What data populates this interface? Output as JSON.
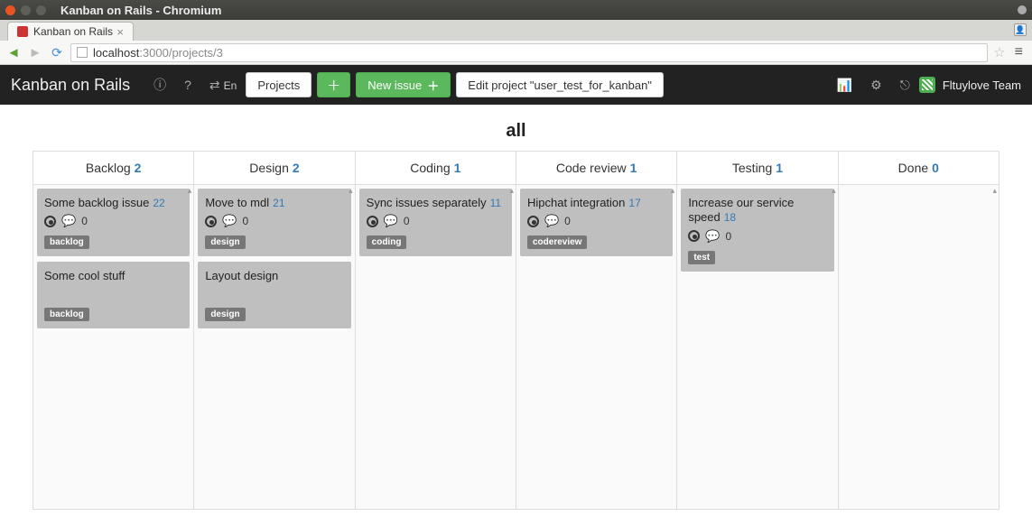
{
  "window": {
    "title": "Kanban on Rails - Chromium"
  },
  "tab": {
    "label": "Kanban on Rails"
  },
  "url": {
    "host": "localhost",
    "rest": ":3000/projects/3"
  },
  "nav": {
    "brand": "Kanban on Rails",
    "lang": "En",
    "projects_label": "Projects",
    "new_issue_label": "New issue",
    "edit_project_label": "Edit project \"user_test_for_kanban\"",
    "team_name": "Fltuylove Team"
  },
  "board": {
    "title": "all",
    "columns": [
      {
        "name": "Backlog",
        "count": 2
      },
      {
        "name": "Design",
        "count": 2
      },
      {
        "name": "Coding",
        "count": 1
      },
      {
        "name": "Code review",
        "count": 1
      },
      {
        "name": "Testing",
        "count": 1
      },
      {
        "name": "Done",
        "count": 0
      }
    ],
    "cards": {
      "backlog": [
        {
          "title": "Some backlog issue",
          "num": "22",
          "comments": 0,
          "tag": "backlog"
        },
        {
          "title": "Some cool stuff",
          "num": "",
          "comments": null,
          "tag": "backlog"
        }
      ],
      "design": [
        {
          "title": "Move to mdl",
          "num": "21",
          "comments": 0,
          "tag": "design"
        },
        {
          "title": "Layout design",
          "num": "",
          "comments": null,
          "tag": "design"
        }
      ],
      "coding": [
        {
          "title": "Sync issues separately",
          "num": "11",
          "comments": 0,
          "tag": "coding"
        }
      ],
      "codereview": [
        {
          "title": "Hipchat integration",
          "num": "17",
          "comments": 0,
          "tag": "codereview"
        }
      ],
      "testing": [
        {
          "title": "Increase our service speed",
          "num": "18",
          "comments": 0,
          "tag": "test"
        }
      ],
      "done": []
    }
  }
}
